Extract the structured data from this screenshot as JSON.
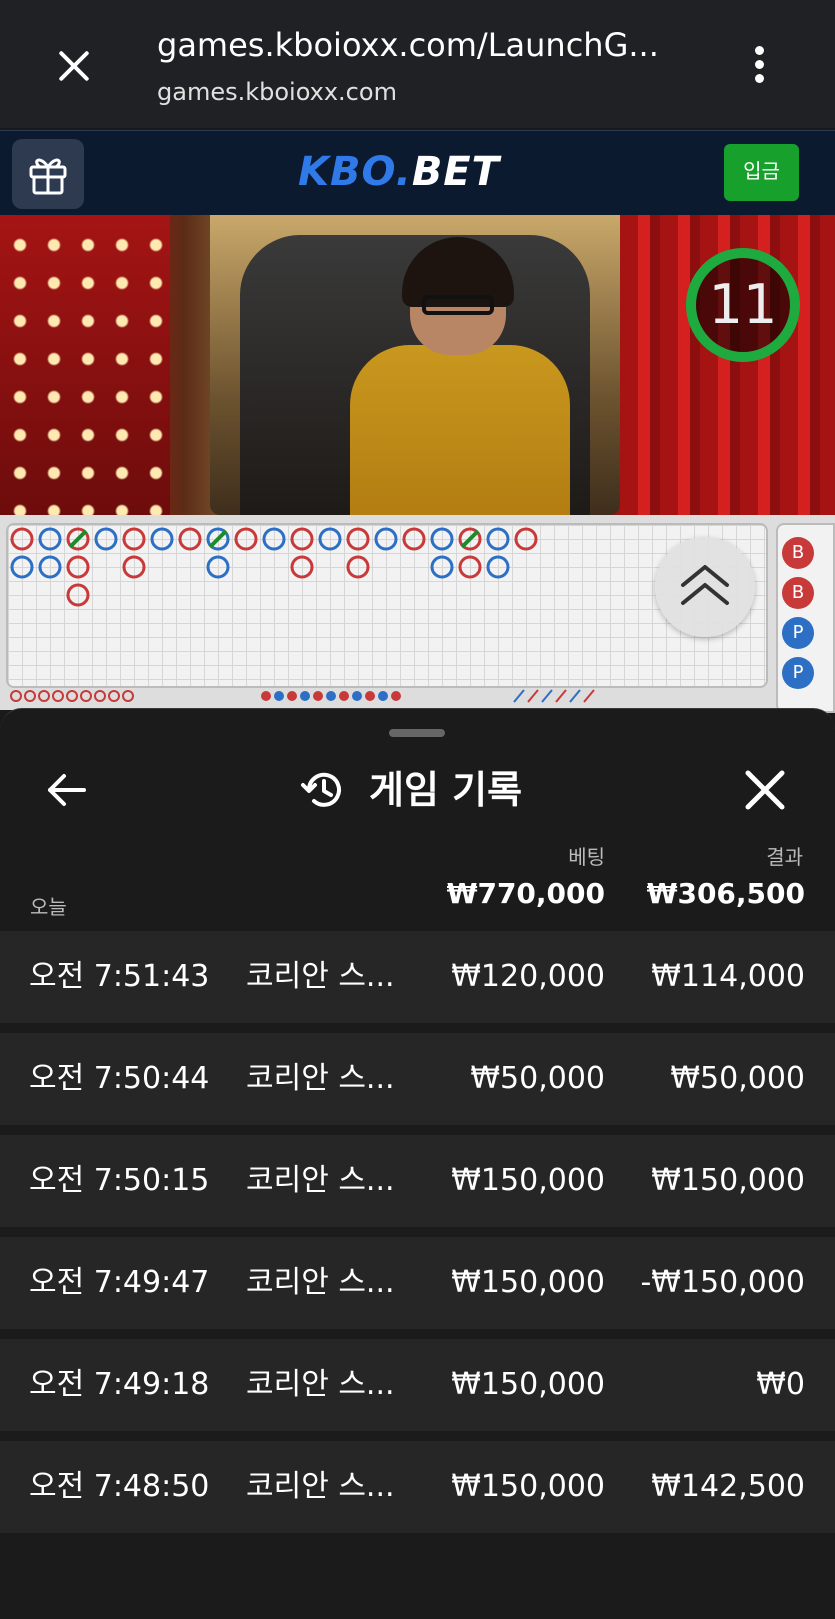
{
  "browser": {
    "url_title": "games.kboioxx.com/LaunchG...",
    "url_domain": "games.kboioxx.com"
  },
  "site": {
    "logo_part1": "KBO.",
    "logo_part2": "BET",
    "deposit_label": "입금"
  },
  "video": {
    "timer": "11"
  },
  "roadmap": {
    "bead_road": [
      "B",
      "B",
      "P",
      "P"
    ]
  },
  "sheet": {
    "title": "게임 기록",
    "col_bet": "베팅",
    "col_result": "결과",
    "today_label": "오늘",
    "total_bet": "₩770,000",
    "total_result": "₩306,500",
    "rows": [
      {
        "time": "오전 7:51:43",
        "game": "코리안 스...",
        "bet": "₩120,000",
        "result": "₩114,000"
      },
      {
        "time": "오전 7:50:44",
        "game": "코리안 스...",
        "bet": "₩50,000",
        "result": "₩50,000"
      },
      {
        "time": "오전 7:50:15",
        "game": "코리안 스...",
        "bet": "₩150,000",
        "result": "₩150,000"
      },
      {
        "time": "오전 7:49:47",
        "game": "코리안 스...",
        "bet": "₩150,000",
        "result": "-₩150,000"
      },
      {
        "time": "오전 7:49:18",
        "game": "코리안 스...",
        "bet": "₩150,000",
        "result": "₩0"
      },
      {
        "time": "오전 7:48:50",
        "game": "코리안 스...",
        "bet": "₩150,000",
        "result": "₩142,500"
      }
    ]
  },
  "colors": {
    "accent_green": "#17a02c",
    "logo_blue": "#2f7ae8",
    "banker_red": "#c83a3a",
    "player_blue": "#2c6fc4"
  }
}
